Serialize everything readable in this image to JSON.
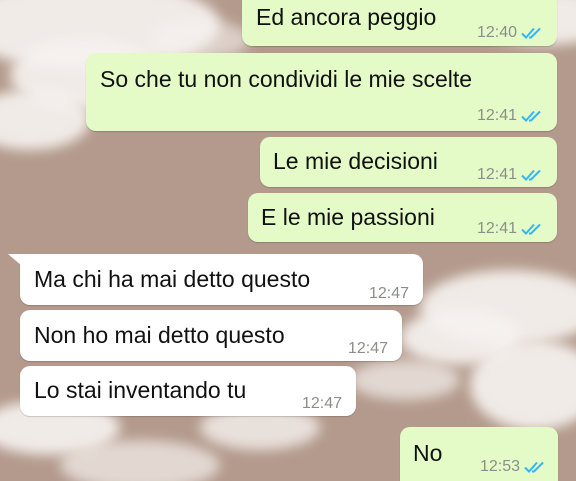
{
  "colors": {
    "background": "#b39a8c",
    "outgoing_bubble": "#e4fbc8",
    "incoming_bubble": "#ffffff",
    "read_ticks": "#34b7f1",
    "time_text": "#8a8f8a"
  },
  "icons": {
    "read_receipt": "double-check-icon"
  },
  "messages": [
    {
      "direction": "outgoing",
      "text": "Ed ancora peggio",
      "time": "12:40",
      "status": "read"
    },
    {
      "direction": "outgoing",
      "text": "So che tu non condividi le mie scelte",
      "time": "12:41",
      "status": "read"
    },
    {
      "direction": "outgoing",
      "text": "Le mie decisioni",
      "time": "12:41",
      "status": "read"
    },
    {
      "direction": "outgoing",
      "text": "E le mie passioni",
      "time": "12:41",
      "status": "read"
    },
    {
      "direction": "incoming",
      "text": "Ma chi ha mai detto questo",
      "time": "12:47"
    },
    {
      "direction": "incoming",
      "text": "Non ho mai detto questo",
      "time": "12:47"
    },
    {
      "direction": "incoming",
      "text": "Lo stai inventando tu",
      "time": "12:47"
    },
    {
      "direction": "outgoing",
      "text": "No",
      "time": "12:53",
      "status": "read"
    }
  ]
}
